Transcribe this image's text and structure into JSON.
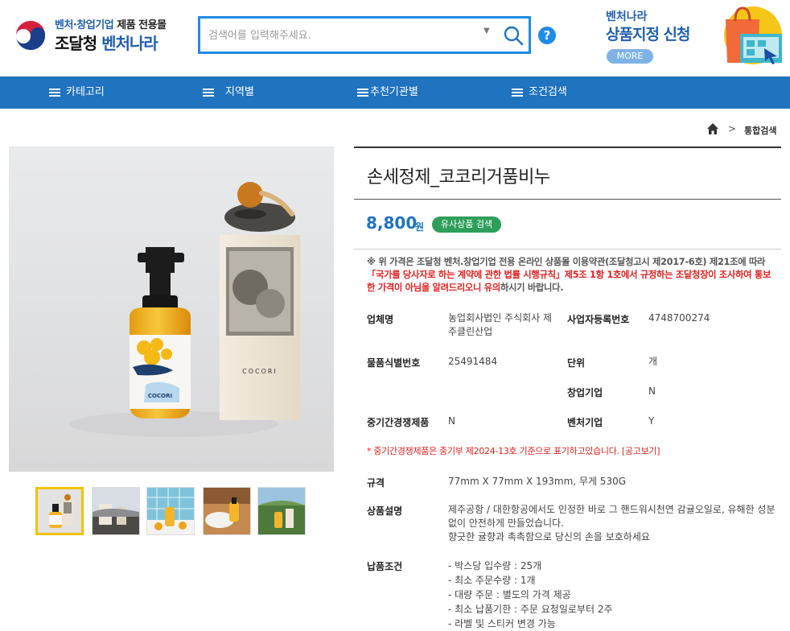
{
  "header": {
    "logo_top_part1": "벤처·창업기업",
    "logo_top_part2": "제품 전용몰",
    "logo_main_part1": "조달청",
    "logo_main_part2": "벤처나라",
    "search_placeholder": "검색어를 입력해주세요.",
    "help_label": "?",
    "promo_sub": "벤처나라",
    "promo_title": "상품지정 신청",
    "promo_more": "MORE"
  },
  "nav": {
    "items": [
      {
        "label": "카테고리"
      },
      {
        "label": "지역별"
      },
      {
        "label": "추천기관별"
      },
      {
        "label": "조건검색"
      }
    ]
  },
  "breadcrumb": {
    "separator": ">",
    "current": "통합검색"
  },
  "product": {
    "title": "손세정제_코코리거품비누",
    "price": "8,800",
    "price_unit": "원",
    "similar_button": "유사상품 검색",
    "box_brand": "COCORI",
    "bottle_brand": "COCORI",
    "notice_part1": "※ 위 가격은 조달청 벤처.창업기업 전용 온라인 상품몰 이용약관(조달청고시 제2017-6호) 제21조에 따라",
    "notice_red": "「국가를 당사자로 하는 계약에 관한 법률 시행규칙」제5조 1항 1호에서 규정하는 조달청장이 조사하여 통보한 가격이 아님을 알려드리오니 유의",
    "notice_part2": "하시기 바랍니다.",
    "specs": {
      "company_label": "업체명",
      "company_value": "농업회사법인 주식회사 제주클린산업",
      "bizno_label": "사업자등록번호",
      "bizno_value": "4748700274",
      "itemno_label": "물품식별번호",
      "itemno_value": "25491484",
      "unit_label": "단위",
      "unit_value": "개",
      "startup_label": "창업기업",
      "startup_value": "N",
      "sme_label": "중기간경쟁제품",
      "sme_value": "N",
      "venture_label": "벤처기업",
      "venture_value": "Y"
    },
    "sme_note": "* 중기간경쟁제품은 중기부 제2024-13호 기준으로 표기하고있습니다. [공고보기]",
    "size_label": "규격",
    "size_value": "77mm X 77mm X 193mm, 무게 530G",
    "desc_label": "상품설명",
    "desc_line1": "제주공항 / 대한항공에서도 인정한 바로 그 핸드워시천연 감귤오일로, 유해한 성분 없이 안전하게 만들었습니다.",
    "desc_line2": "향긋한 귤향과 촉촉함으로 당신의 손을 보호하세요",
    "delivery_label": "납품조건",
    "delivery_lines": [
      "- 박스당 입수량 :  25개",
      "- 최소 주문수량 : 1개",
      "- 대량 주문 :  별도의 가격 제공",
      "- 최소 납품기한 :  주문 요청일로부터 2주",
      "- 라벨 및 스티커 변경 가능"
    ]
  },
  "colors": {
    "accent_blue": "#1f73bf",
    "search_border": "#1f8ce6",
    "green_button": "#2e9e5b",
    "notice_red": "#e02020",
    "thumb_active": "#f2c200"
  }
}
